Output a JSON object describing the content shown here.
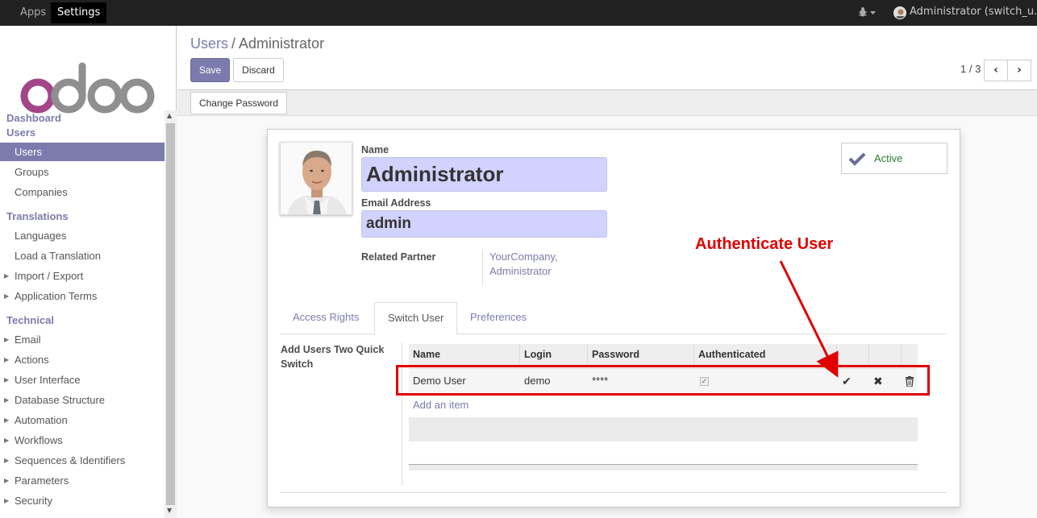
{
  "topbar": {
    "apps_label": "Apps",
    "settings_label": "Settings",
    "debug_icon": "bug-icon",
    "user_label": "Administrator (switch_u..."
  },
  "sidebar": {
    "logo_text": "odoo",
    "sections": {
      "dashboard": "Dashboard",
      "users": "Users",
      "translations": "Translations",
      "technical": "Technical"
    },
    "items": {
      "users": "Users",
      "groups": "Groups",
      "companies": "Companies",
      "languages": "Languages",
      "load_translation": "Load a Translation",
      "import_export": "Import / Export",
      "application_terms": "Application Terms",
      "email": "Email",
      "actions": "Actions",
      "user_interface": "User Interface",
      "database_structure": "Database Structure",
      "automation": "Automation",
      "workflows": "Workflows",
      "sequences": "Sequences & Identifiers",
      "parameters": "Parameters",
      "security": "Security"
    }
  },
  "control_panel": {
    "breadcrumb_parent": "Users",
    "breadcrumb_sep": "/",
    "breadcrumb_current": "Administrator",
    "save_label": "Save",
    "discard_label": "Discard",
    "pager": "1 / 3"
  },
  "statusbar": {
    "change_password_label": "Change Password"
  },
  "form": {
    "name_label": "Name",
    "name_value": "Administrator",
    "email_label": "Email Address",
    "email_value": "admin",
    "related_partner_label": "Related Partner",
    "related_partner_line1": "YourCompany,",
    "related_partner_line2": "Administrator",
    "active_label": "Active",
    "tabs": [
      "Access Rights",
      "Switch User",
      "Preferences"
    ],
    "group_label": "Add Users Two Quick Switch",
    "table": {
      "headers": [
        "Name",
        "Login",
        "Password",
        "Authenticated"
      ],
      "rows": [
        {
          "name": "Demo User",
          "login": "demo",
          "password": "****",
          "authenticated": true
        }
      ],
      "add_item": "Add an item"
    }
  },
  "annotation": {
    "text": "Authenticate User",
    "color": "#e00000"
  },
  "colors": {
    "accent": "#7c7bad",
    "topbar": "#212121",
    "input_bg": "#d2d2ff"
  }
}
